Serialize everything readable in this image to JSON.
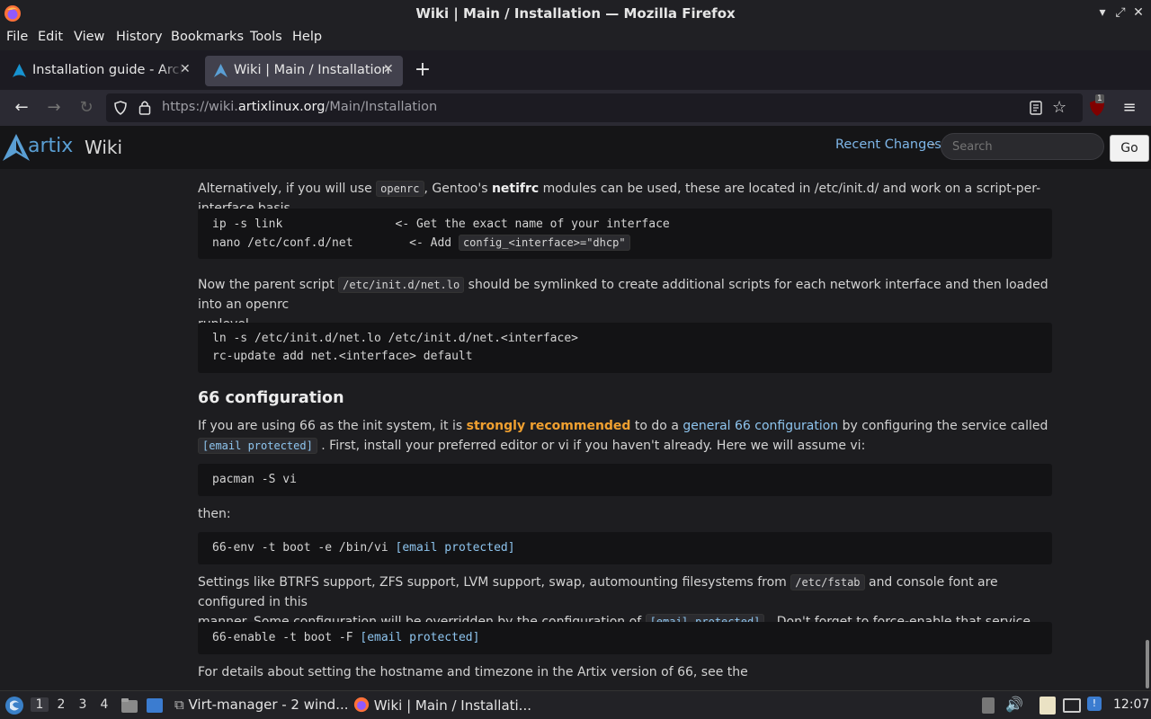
{
  "window": {
    "title": "Wiki | Main / Installation — Mozilla Firefox",
    "controls": [
      "minimize",
      "maximize",
      "close"
    ]
  },
  "menu": [
    "File",
    "Edit",
    "View",
    "History",
    "Bookmarks",
    "Tools",
    "Help"
  ],
  "tabs": [
    {
      "label": "Installation guide - ArchWiki",
      "active": false
    },
    {
      "label": "Wiki | Main / Installation",
      "active": true
    }
  ],
  "nav": {
    "url_prefix": "https://wiki.",
    "url_domain": "artixlinux.org",
    "url_path": "/Main/Installation",
    "extension_badge": "1"
  },
  "wiki": {
    "logo": "artix",
    "logo_suffix": "Wiki",
    "recent_changes": "Recent Changes",
    "separator": "-",
    "search_placeholder": "Search",
    "go_label": "Go"
  },
  "content": {
    "p1_before": "Alternatively, if you will use",
    "p1_code": "openrc",
    "p1_mid": ", Gentoo's",
    "p1_bold": "netifrc",
    "p1_after": "modules can be used, these are located in /etc/init.d/ and work on a script-per-interface basis.",
    "pre1_line1": "ip -s link                <- Get the exact name of your interface",
    "pre1_line2": "nano /etc/conf.d/net        <- Add ",
    "pre1_line2_code": "config_<interface>=\"dhcp\"",
    "p2_before": "Now the parent script",
    "p2_code": "/etc/init.d/net.lo",
    "p2_after": "should be symlinked to create additional scripts for each network interface and then loaded into an openrc",
    "p2_line2": "runlevel.",
    "pre2_line1": "ln -s /etc/init.d/net.lo /etc/init.d/net.<interface>",
    "pre2_line2": "rc-update add net.<interface> default",
    "h_66": "66 configuration",
    "p3_before": "If you are using 66 as the init system, it is",
    "p3_strong": "strongly recommended",
    "p3_mid": "to do a",
    "p3_link": "general 66 configuration",
    "p3_after": "by configuring the service called",
    "p3_code": "[email protected]",
    "p3_line2": ". First, install your preferred editor or vi if you haven't already. Here we will assume vi:",
    "pre3": "pacman -S vi",
    "p4": "then:",
    "pre4_cmd": "66-env -t boot -e /bin/vi ",
    "pre4_link": "[email protected]",
    "p5_before": "Settings like BTRFS support, ZFS support, LVM support, swap, automounting filesystems from",
    "p5_code": "/etc/fstab",
    "p5_after": "and console font are configured in this",
    "p5_line2_before": "manner. Some configuration will be overridden by the configuration of",
    "p5_code2": "[email protected]",
    "p5_line2_after": ". Don't forget to force-enable that service afterwards:",
    "pre5_cmd": "66-enable -t boot -F ",
    "pre5_link": "[email protected]",
    "p6": "For details about setting the hostname and timezone in the Artix version of 66, see the"
  },
  "taskbar": {
    "workspaces": [
      "1",
      "2",
      "3",
      "4"
    ],
    "tasks": [
      {
        "label": "Virt-manager - 2 wind..."
      },
      {
        "label": "Wiki | Main / Installati..."
      }
    ],
    "clock": "12:07"
  },
  "colors": {
    "accent": "#5a9fd4",
    "link": "#8ec5ef",
    "strong": "#f0a030"
  }
}
